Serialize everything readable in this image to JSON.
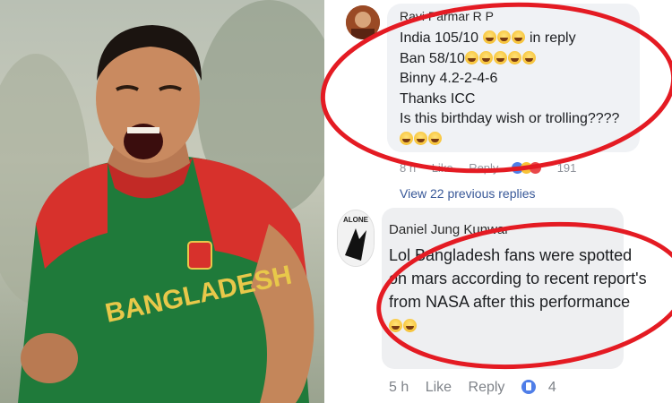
{
  "comment_top": {
    "author": "Ravi Parmar R P",
    "lines": [
      "India 105/10",
      "in reply",
      "Ban 58/10",
      "Binny 4.2-2-4-6",
      "Thanks ICC",
      "Is this birthday wish or trolling????"
    ],
    "time": "8 h",
    "like": "Like",
    "reply": "Reply",
    "reaction_count": "191",
    "view_replies": "View 22 previous replies"
  },
  "comment_bottom": {
    "author": "Daniel Jung Kunwar",
    "avatar_text": "ALONE",
    "lines": [
      "Lol Bangladesh fans were spotted",
      "on mars according to recent report's",
      "from NASA after this performance"
    ],
    "time": "5 h",
    "like": "Like",
    "reply": "Reply",
    "like_count": "4"
  },
  "photo": {
    "jersey_text": "BANGLADESH"
  },
  "colors": {
    "jersey_green": "#1f7a3a",
    "jersey_red": "#d7312c",
    "highlight_red": "#e41b23",
    "link_blue": "#385898",
    "bubble_gray": "#f0f2f5"
  }
}
